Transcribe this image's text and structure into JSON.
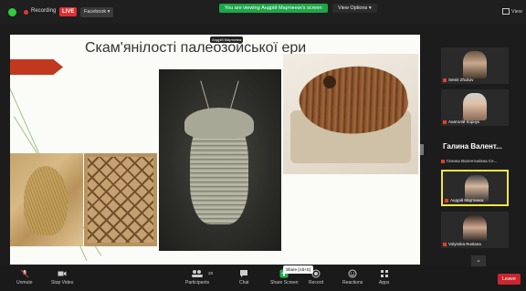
{
  "topbar": {
    "recording_label": "Recording",
    "live_label": "LIVE",
    "facebook_label": "Facebook ▾",
    "viewing_banner": "You are viewing Андрій Мартинюк's screen",
    "view_options": "View Options ▾",
    "view_label": "View"
  },
  "slide": {
    "title": "Скам'янілості палеозойської ери",
    "speaker_badge": "Андрій Мартинюк"
  },
  "participants": {
    "tiles": [
      {
        "name": "Semit Zhukov"
      },
      {
        "name": "Анатолій Корнук"
      },
      {
        "name": "Андрій Мартинюк"
      },
      {
        "name": "Volynska Ruslana"
      }
    ],
    "active_speaker_big": "Галина Валент...",
    "active_speaker_sub": "Галина Валентинівна Се..."
  },
  "toolbar": {
    "unmute": "Unmute",
    "stop_video": "Stop Video",
    "participants": "Participants",
    "participants_count": "28",
    "chat": "Chat",
    "share_screen": "Share Screen",
    "record": "Record",
    "reactions": "Reactions",
    "apps": "Apps",
    "leave": "Leave",
    "share_tooltip": "Share (Alt+S)"
  },
  "colors": {
    "live": "#e02f2f",
    "banner_green": "#1fa64a",
    "leave": "#c8272d",
    "active_border": "#f2e64a"
  }
}
